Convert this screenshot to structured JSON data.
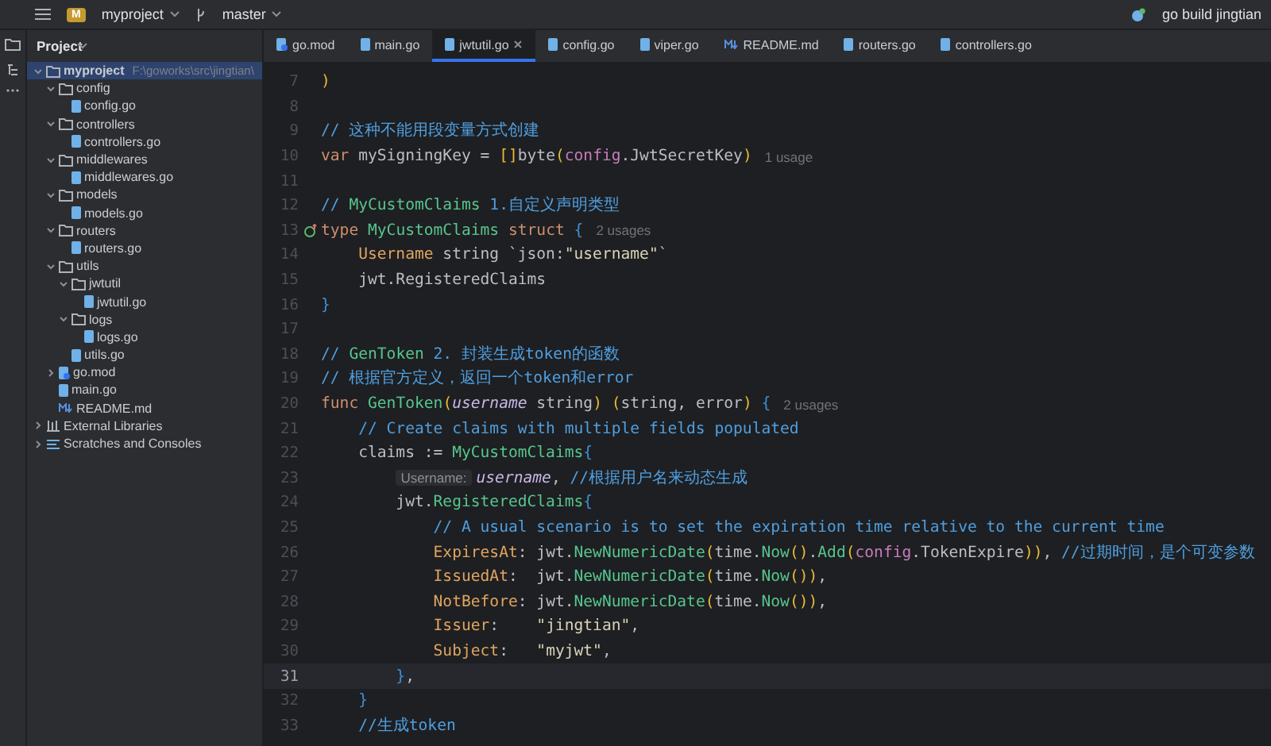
{
  "toolbar": {
    "project": {
      "badge": "M",
      "name": "myproject"
    },
    "branch": "master",
    "run_config": "go build jingtian"
  },
  "sidebar": {
    "title": "Project",
    "tree": [
      {
        "kind": "folder",
        "label": "myproject",
        "path": "F:\\goworks\\src\\jingtian\\",
        "selected": true,
        "expanded": true,
        "children": [
          {
            "kind": "folder",
            "label": "config",
            "selected": false,
            "expanded": true,
            "children": [
              {
                "kind": "gofile",
                "label": "config.go",
                "selected": false
              }
            ]
          },
          {
            "kind": "folder",
            "label": "controllers",
            "selected": false,
            "expanded": true,
            "children": [
              {
                "kind": "gofile",
                "label": "controllers.go",
                "selected": false
              }
            ]
          },
          {
            "kind": "folder",
            "label": "middlewares",
            "selected": false,
            "expanded": true,
            "children": [
              {
                "kind": "gofile",
                "label": "middlewares.go",
                "selected": false
              }
            ]
          },
          {
            "kind": "folder",
            "label": "models",
            "selected": false,
            "expanded": true,
            "children": [
              {
                "kind": "gofile",
                "label": "models.go",
                "selected": false
              }
            ]
          },
          {
            "kind": "folder",
            "label": "routers",
            "selected": false,
            "expanded": true,
            "children": [
              {
                "kind": "gofile",
                "label": "routers.go",
                "selected": false
              }
            ]
          },
          {
            "kind": "folder",
            "label": "utils",
            "selected": false,
            "expanded": true,
            "children": [
              {
                "kind": "folder",
                "label": "jwtutil",
                "selected": false,
                "expanded": true,
                "children": [
                  {
                    "kind": "gofile",
                    "label": "jwtutil.go",
                    "selected": false
                  }
                ]
              },
              {
                "kind": "folder",
                "label": "logs",
                "selected": false,
                "expanded": true,
                "children": [
                  {
                    "kind": "gofile",
                    "label": "logs.go",
                    "selected": false
                  }
                ]
              },
              {
                "kind": "gofile",
                "label": "utils.go",
                "selected": false
              }
            ]
          },
          {
            "kind": "gomod",
            "label": "go.mod",
            "selected": false,
            "expanded": false
          },
          {
            "kind": "gofile",
            "label": "main.go",
            "selected": false
          },
          {
            "kind": "mdfile",
            "label": "README.md",
            "selected": false
          }
        ]
      },
      {
        "kind": "library",
        "label": "External Libraries",
        "selected": false,
        "expanded": false
      },
      {
        "kind": "scratches",
        "label": "Scratches and Consoles",
        "selected": false,
        "expanded": false
      }
    ]
  },
  "tabs": [
    {
      "kind": "gomod",
      "label": "go.mod",
      "selected": false
    },
    {
      "kind": "gofile",
      "label": "main.go",
      "selected": false
    },
    {
      "kind": "gofile",
      "label": "jwtutil.go",
      "selected": true
    },
    {
      "kind": "gofile",
      "label": "config.go",
      "selected": false
    },
    {
      "kind": "gofile",
      "label": "viper.go",
      "selected": false
    },
    {
      "kind": "mdfile",
      "label": "README.md",
      "selected": false
    },
    {
      "kind": "gofile",
      "label": "routers.go",
      "selected": false
    },
    {
      "kind": "gofile",
      "label": "controllers.go",
      "selected": false
    }
  ],
  "editor": {
    "lines": [
      {
        "number": "7",
        "tokens": [
          {
            "kind": "bracket",
            "text": ")"
          }
        ]
      },
      {
        "number": "8"
      },
      {
        "number": "9",
        "tokens": [
          {
            "kind": "comment",
            "text": "// 这种不能用段变量方式创建"
          }
        ]
      },
      {
        "number": "10",
        "tokens": [
          {
            "kind": "keyword",
            "text": "var"
          },
          {
            "kind": "plain",
            "text": " mySigningKey = "
          },
          {
            "kind": "bracket",
            "text": "[]"
          },
          {
            "kind": "plain",
            "text": "byte"
          },
          {
            "kind": "bracket",
            "text": "("
          },
          {
            "kind": "package",
            "text": "config"
          },
          {
            "kind": "plain",
            "text": ".JwtSecretKey"
          },
          {
            "kind": "bracket",
            "text": ")"
          },
          {
            "kind": "usage",
            "text": "1 usage"
          }
        ]
      },
      {
        "number": "11"
      },
      {
        "number": "12",
        "tokens": [
          {
            "kind": "comment",
            "text": "// "
          },
          {
            "kind": "type",
            "text": "MyCustomClaims"
          },
          {
            "kind": "comment",
            "text": " 1.自定义声明类型"
          }
        ]
      },
      {
        "number": "13",
        "gutter_mark": true,
        "tokens": [
          {
            "kind": "keyword",
            "text": "type "
          },
          {
            "kind": "type",
            "text": "MyCustomClaims "
          },
          {
            "kind": "keyword",
            "text": "struct "
          },
          {
            "kind": "brace",
            "text": "{"
          },
          {
            "kind": "usage",
            "text": "2 usages"
          }
        ]
      },
      {
        "number": "14",
        "tokens": [
          {
            "kind": "field",
            "text": "    Username"
          },
          {
            "kind": "plain",
            "text": " string `json:"
          },
          {
            "kind": "string",
            "text": "\"username\""
          },
          {
            "kind": "plain",
            "text": "`"
          }
        ]
      },
      {
        "number": "15",
        "tokens": [
          {
            "kind": "plain",
            "text": "    jwt.RegisteredClaims"
          }
        ]
      },
      {
        "number": "16",
        "tokens": [
          {
            "kind": "brace",
            "text": "}"
          }
        ]
      },
      {
        "number": "17"
      },
      {
        "number": "18",
        "tokens": [
          {
            "kind": "comment",
            "text": "// "
          },
          {
            "kind": "function",
            "text": "GenToken"
          },
          {
            "kind": "comment",
            "text": " 2. 封装生成token的函数"
          }
        ]
      },
      {
        "number": "19",
        "tokens": [
          {
            "kind": "comment",
            "text": "// 根据官方定义，返回一个token和error"
          }
        ]
      },
      {
        "number": "20",
        "tokens": [
          {
            "kind": "keyword",
            "text": "func "
          },
          {
            "kind": "function",
            "text": "GenToken"
          },
          {
            "kind": "bracket",
            "text": "("
          },
          {
            "kind": "param",
            "text": "username"
          },
          {
            "kind": "plain",
            "text": " string"
          },
          {
            "kind": "bracket",
            "text": ") ("
          },
          {
            "kind": "plain",
            "text": "string, error"
          },
          {
            "kind": "bracket",
            "text": ") "
          },
          {
            "kind": "brace",
            "text": "{"
          },
          {
            "kind": "usage",
            "text": "2 usages"
          }
        ]
      },
      {
        "number": "21",
        "tokens": [
          {
            "kind": "comment",
            "text": "    // Create claims with multiple fields populated"
          }
        ]
      },
      {
        "number": "22",
        "tokens": [
          {
            "kind": "plain",
            "text": "    claims := "
          },
          {
            "kind": "type",
            "text": "MyCustomClaims"
          },
          {
            "kind": "brace",
            "text": "{"
          }
        ]
      },
      {
        "number": "23",
        "tokens": [
          {
            "kind": "hint",
            "text": "        Username:"
          },
          {
            "kind": "param",
            "text": "username"
          },
          {
            "kind": "plain",
            "text": ", "
          },
          {
            "kind": "comment",
            "text": "//根据用户名来动态生成"
          }
        ]
      },
      {
        "number": "24",
        "tokens": [
          {
            "kind": "plain",
            "text": "        jwt."
          },
          {
            "kind": "type",
            "text": "RegisteredClaims"
          },
          {
            "kind": "brace",
            "text": "{"
          }
        ]
      },
      {
        "number": "25",
        "tokens": [
          {
            "kind": "comment",
            "text": "            // A usual scenario is to set the expiration time relative to the current time"
          }
        ]
      },
      {
        "number": "26",
        "tokens": [
          {
            "kind": "field",
            "text": "            ExpiresAt"
          },
          {
            "kind": "plain",
            "text": ": jwt."
          },
          {
            "kind": "function",
            "text": "NewNumericDate"
          },
          {
            "kind": "bracket",
            "text": "("
          },
          {
            "kind": "plain",
            "text": "time."
          },
          {
            "kind": "function",
            "text": "Now"
          },
          {
            "kind": "bracket",
            "text": "()"
          },
          {
            "kind": "plain",
            "text": "."
          },
          {
            "kind": "function",
            "text": "Add"
          },
          {
            "kind": "bracket",
            "text": "("
          },
          {
            "kind": "package",
            "text": "config"
          },
          {
            "kind": "plain",
            "text": ".TokenExpire"
          },
          {
            "kind": "bracket",
            "text": "))"
          },
          {
            "kind": "plain",
            "text": ", "
          },
          {
            "kind": "comment",
            "text": "//过期时间，是个可变参数"
          }
        ]
      },
      {
        "number": "27",
        "tokens": [
          {
            "kind": "field",
            "text": "            IssuedAt"
          },
          {
            "kind": "plain",
            "text": ":  jwt."
          },
          {
            "kind": "function",
            "text": "NewNumericDate"
          },
          {
            "kind": "bracket",
            "text": "("
          },
          {
            "kind": "plain",
            "text": "time."
          },
          {
            "kind": "function",
            "text": "Now"
          },
          {
            "kind": "bracket",
            "text": "())"
          },
          {
            "kind": "plain",
            "text": ","
          }
        ]
      },
      {
        "number": "28",
        "tokens": [
          {
            "kind": "field",
            "text": "            NotBefore"
          },
          {
            "kind": "plain",
            "text": ": jwt."
          },
          {
            "kind": "function",
            "text": "NewNumericDate"
          },
          {
            "kind": "bracket",
            "text": "("
          },
          {
            "kind": "plain",
            "text": "time."
          },
          {
            "kind": "function",
            "text": "Now"
          },
          {
            "kind": "bracket",
            "text": "())"
          },
          {
            "kind": "plain",
            "text": ","
          }
        ]
      },
      {
        "number": "29",
        "tokens": [
          {
            "kind": "field",
            "text": "            Issuer"
          },
          {
            "kind": "plain",
            "text": ":    "
          },
          {
            "kind": "string",
            "text": "\"jingtian\""
          },
          {
            "kind": "plain",
            "text": ","
          }
        ]
      },
      {
        "number": "30",
        "tokens": [
          {
            "kind": "field",
            "text": "            Subject"
          },
          {
            "kind": "plain",
            "text": ":   "
          },
          {
            "kind": "string",
            "text": "\"myjwt\""
          },
          {
            "kind": "plain",
            "text": ","
          }
        ]
      },
      {
        "number": "31",
        "current": true,
        "tokens": [
          {
            "kind": "brace",
            "text": "        }"
          },
          {
            "kind": "plain",
            "text": ","
          }
        ]
      },
      {
        "number": "32",
        "tokens": [
          {
            "kind": "brace",
            "text": "    }"
          }
        ]
      },
      {
        "number": "33",
        "tokens": [
          {
            "kind": "comment",
            "text": "    //生成token"
          }
        ]
      }
    ]
  }
}
